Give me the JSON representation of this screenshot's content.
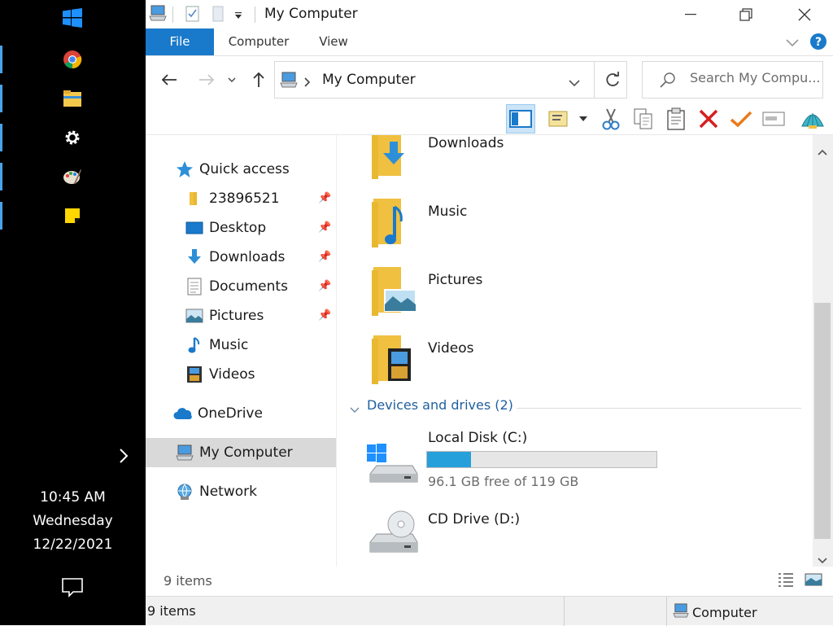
{
  "taskbar": {
    "apps": [
      "start-icon",
      "chrome-icon",
      "file-explorer-icon",
      "settings-icon",
      "paint-icon",
      "sticky-notes-icon"
    ],
    "time": "10:45 AM",
    "day": "Wednesday",
    "date": "12/22/2021"
  },
  "window": {
    "title": "My Computer",
    "tabs": {
      "file": "File",
      "computer": "Computer",
      "view": "View"
    }
  },
  "address": {
    "path": "My Computer",
    "search_placeholder": "Search My Compu..."
  },
  "nav": {
    "quick_access": "Quick access",
    "items": [
      {
        "label": "23896521",
        "pinned": true
      },
      {
        "label": "Desktop",
        "pinned": true
      },
      {
        "label": "Downloads",
        "pinned": true
      },
      {
        "label": "Documents",
        "pinned": true
      },
      {
        "label": "Pictures",
        "pinned": true
      },
      {
        "label": "Music",
        "pinned": false
      },
      {
        "label": "Videos",
        "pinned": false
      }
    ],
    "onedrive": "OneDrive",
    "my_computer": "My Computer",
    "network": "Network"
  },
  "content": {
    "folders": [
      "Downloads",
      "Music",
      "Pictures",
      "Videos"
    ],
    "group_header": "Devices and drives (2)",
    "drives": [
      {
        "name": "Local Disk (C:)",
        "free_text": "96.1 GB free of 119 GB",
        "used_fraction": 0.19
      },
      {
        "name": "CD Drive (D:)"
      }
    ]
  },
  "status": {
    "items_count": "9 items",
    "items_count_bottom": "9 items",
    "zone": "Computer"
  },
  "colors": {
    "accent": "#1979ca",
    "drive_fill": "#26a0da",
    "folder": "#f5c94c"
  }
}
